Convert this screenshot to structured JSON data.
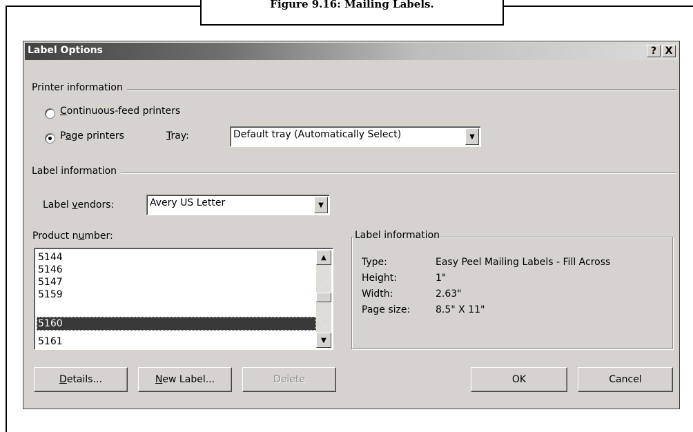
{
  "figure": {
    "caption": "Figure 9.16: Mailing Labels."
  },
  "dialog": {
    "title": "Label Options",
    "help_button": "?",
    "close_button": "X"
  },
  "printer_info": {
    "group_label": "Printer information",
    "continuous": {
      "pre": "",
      "mnemonic": "C",
      "post": "ontinuous-feed printers",
      "checked": false
    },
    "page": {
      "pre": "P",
      "mnemonic": "a",
      "post": "ge printers",
      "checked": true
    },
    "tray_label": {
      "mnemonic": "T",
      "post": "ray:"
    },
    "tray_value": "Default tray (Automatically Select)"
  },
  "label_info": {
    "group_label": "Label information",
    "vendors_label": {
      "pre": "Label ",
      "mnemonic": "v",
      "post": "endors:"
    },
    "vendors_value": "Avery US Letter"
  },
  "product": {
    "label": {
      "pre": "Product n",
      "mnemonic": "u",
      "post": "mber:"
    },
    "items": [
      "5144",
      "5146",
      "5147",
      "5159",
      "5160",
      "5161"
    ],
    "selected": "5160"
  },
  "details_panel": {
    "title": "Label information",
    "rows": [
      {
        "key": "Type:",
        "value": "Easy Peel Mailing Labels - Fill Across"
      },
      {
        "key": "Height:",
        "value": "1\""
      },
      {
        "key": "Width:",
        "value": "2.63\""
      },
      {
        "key": "Page size:",
        "value": "8.5\" X 11\""
      }
    ]
  },
  "buttons": {
    "details": {
      "mnemonic": "D",
      "post": "etails..."
    },
    "new_label": {
      "mnemonic": "N",
      "post": "ew Label..."
    },
    "delete": "Delete",
    "ok": "OK",
    "cancel": "Cancel"
  }
}
